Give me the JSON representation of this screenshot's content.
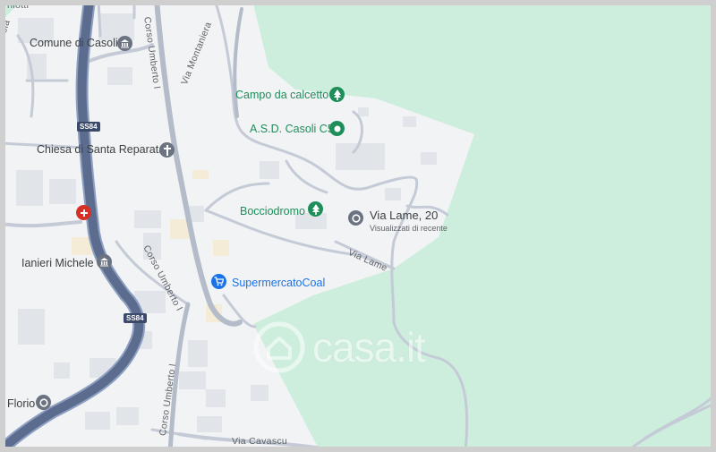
{
  "map": {
    "colors": {
      "land": "#f2f3f5",
      "park": "#cdeedd",
      "road": "#c4cbd6",
      "highway": "#5b6c8f",
      "building": "#e1e4e8",
      "poi_green": "#1e8e5a",
      "poi_blue": "#1a73e8",
      "hospital": "#d93025"
    },
    "places": {
      "comune": "Comune di Casoli",
      "chiesa": "Chiesa di Santa Reparata",
      "campo": "Campo da calcetto",
      "asd": "A.S.D. Casoli C5",
      "bocciodromo": "Bocciodromo",
      "via_lame_20": "Via Lame, 20",
      "recent": "Visualizzati di recente",
      "ianieri": "Ianieri Michele",
      "supermercato": "SupermercatoCoal",
      "florio": "Florio"
    },
    "streets": {
      "rilotti": "rilotti",
      "san_nicola": "Via San Nicola",
      "corso_umberto_top": "Corso Umberto I",
      "via_montaniera": "Via Montaniera",
      "corso_umberto_mid": "Corso Umberto I",
      "corso_umberto_bottom": "Corso Umberto I",
      "via_lame": "Via Lame",
      "via_cavascu": "Via Cavascu"
    },
    "shields": {
      "ss84_top": "SS84",
      "ss84_bottom": "SS84"
    },
    "icons": {
      "town_hall": "town-hall-icon",
      "church": "church-icon",
      "park": "park-icon",
      "sports": "sports-icon",
      "location": "location-pin-icon",
      "hospital": "hospital-icon",
      "shop": "shopping-cart-icon"
    },
    "watermark": "casa.it"
  }
}
